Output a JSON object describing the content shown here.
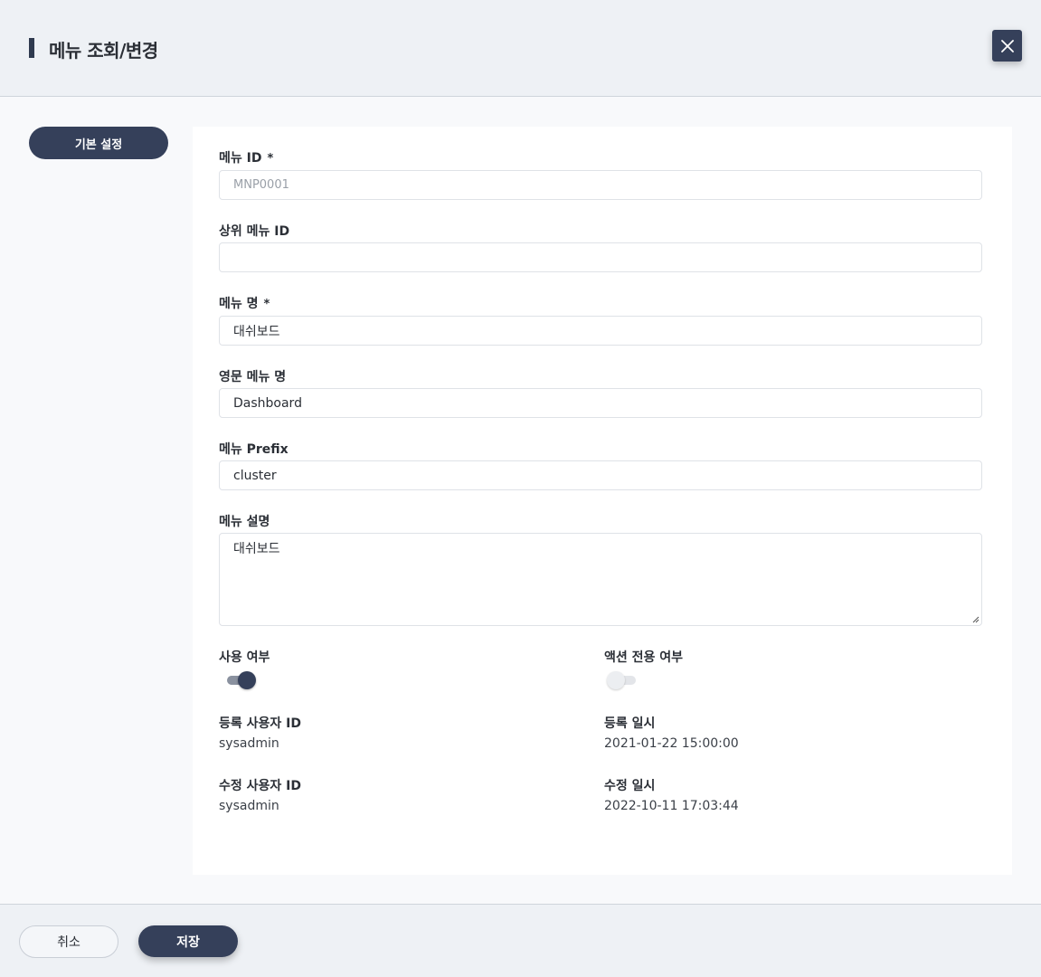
{
  "header": {
    "title": "메뉴 조회/변경"
  },
  "sidebar": {
    "tab_label": "기본 설정"
  },
  "form": {
    "required_mark": "*",
    "menu_id": {
      "label": "메뉴 ID",
      "value": "MNP0001"
    },
    "parent_menu_id": {
      "label": "상위 메뉴 ID",
      "value": ""
    },
    "menu_name": {
      "label": "메뉴 명",
      "value": "대쉬보드"
    },
    "menu_name_en": {
      "label": "영문 메뉴 명",
      "value": "Dashboard"
    },
    "menu_prefix": {
      "label": "메뉴 Prefix",
      "value": "cluster"
    },
    "menu_description": {
      "label": "메뉴 설명",
      "value": "대쉬보드"
    },
    "use_yn": {
      "label": "사용 여부",
      "enabled": true
    },
    "action_only_yn": {
      "label": "액션 전용 여부",
      "enabled": false
    },
    "created_user": {
      "label": "등록 사용자 ID",
      "value": "sysadmin"
    },
    "created_at": {
      "label": "등록 일시",
      "value": "2021-01-22 15:00:00"
    },
    "updated_user": {
      "label": "수정 사용자 ID",
      "value": "sysadmin"
    },
    "updated_at": {
      "label": "수정 일시",
      "value": "2022-10-11 17:03:44"
    }
  },
  "footer": {
    "cancel_label": "취소",
    "save_label": "저장"
  },
  "icons": {
    "close": "close-icon"
  },
  "colors": {
    "primary": "#35405a",
    "header_bg": "#eef1f5",
    "panel_bg": "#ffffff"
  }
}
